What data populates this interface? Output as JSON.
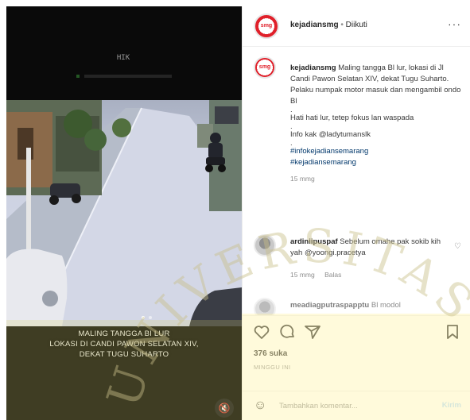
{
  "media": {
    "cam_logo": "HIK",
    "caption_lines": [
      "MALING TANGGA BI LUR",
      "LOKASI DI CANDI PAWON SELATAN XIV,",
      "DEKAT TUGU SUHARTO"
    ],
    "sound_icon": "speaker-muted-icon",
    "carousel_dots": 2,
    "carousel_active": 0
  },
  "header": {
    "username": "kejadiansmg",
    "separator": "•",
    "follow_status": "Diikuti",
    "more": "···"
  },
  "post": {
    "username": "kejadiansmg",
    "lines": [
      "Maling tangga Bl lur, lokasi di Jl Candi Pawon Selatan XIV, dekat Tugu Suharto. Pelaku numpak motor masuk dan mengambil ondo Bl"
    ],
    "warning": "Hati hati lur, tetep fokus lan waspada",
    "info": "Info kak @ladytumanslk",
    "hashtags": [
      "#infokejadiansemarang",
      "#kejadiansemarang"
    ],
    "time": "15 mmg",
    "dots": "."
  },
  "comments": [
    {
      "username": "ardiniipuspaf",
      "text": "Sebelum omahe pak sokib kih yah @yoongi.pracetya",
      "time": "15 mmg",
      "reply": "Balas"
    },
    {
      "username": "meadiagputraspapptu",
      "text": "Bl modol"
    }
  ],
  "actions": {
    "like_icon": "heart-icon",
    "comment_icon": "comment-icon",
    "share_icon": "paper-plane-icon",
    "save_icon": "bookmark-icon"
  },
  "likes": "376 suka",
  "time_ago": "minggu ini",
  "add_comment": {
    "placeholder": "Tambahkan komentar...",
    "post_label": "Kirim",
    "emoji_icon": "smiley-icon"
  },
  "watermark_text": "UNIVERSITAS",
  "colors": {
    "brand_red": "#e0202a",
    "link_blue": "#00376b",
    "post_btn": "#b3dbff",
    "watermark_yellow": "#fff4b0"
  }
}
